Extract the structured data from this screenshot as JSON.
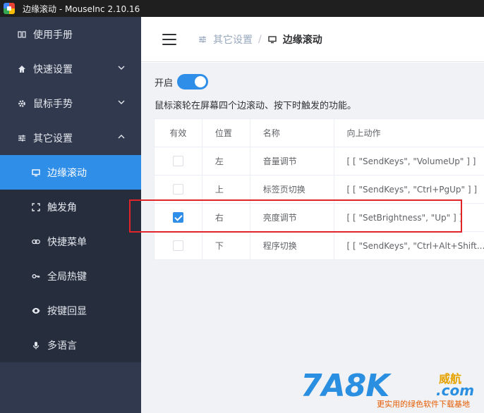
{
  "window": {
    "title": "边缘滚动 - MouseInc 2.10.16"
  },
  "sidebar": {
    "items": [
      {
        "label": "使用手册",
        "icon": "book-icon"
      },
      {
        "label": "快速设置",
        "icon": "home-icon"
      },
      {
        "label": "鼠标手势",
        "icon": "gear-icon"
      },
      {
        "label": "其它设置",
        "icon": "sliders-icon"
      },
      {
        "label": "边缘滚动",
        "icon": "monitor-icon"
      },
      {
        "label": "触发角",
        "icon": "corners-icon"
      },
      {
        "label": "快捷菜单",
        "icon": "link-icon"
      },
      {
        "label": "全局热键",
        "icon": "key-icon"
      },
      {
        "label": "按键回显",
        "icon": "eye-icon"
      },
      {
        "label": "多语言",
        "icon": "mic-icon"
      }
    ]
  },
  "header": {
    "breadcrumb": {
      "parent": "其它设置",
      "current": "边缘滚动"
    }
  },
  "main": {
    "toggle_label": "开启",
    "toggle_on": true,
    "description": "鼠标滚轮在屏幕四个边滚动、按下时触发的功能。",
    "table": {
      "headers": [
        "有效",
        "位置",
        "名称",
        "向上动作"
      ],
      "rows": [
        {
          "enabled": false,
          "position": "左",
          "name": "音量调节",
          "action": "[ [ \"SendKeys\", \"VolumeUp\" ] ]"
        },
        {
          "enabled": false,
          "position": "上",
          "name": "标签页切换",
          "action": "[ [ \"SendKeys\", \"Ctrl+PgUp\" ] ]"
        },
        {
          "enabled": true,
          "position": "右",
          "name": "亮度调节",
          "action": "[ [ \"SetBrightness\", \"Up\" ] ]"
        },
        {
          "enabled": false,
          "position": "下",
          "name": "程序切换",
          "action": "[ [ \"SendKeys\", \"Ctrl+Alt+Shift..."
        }
      ]
    }
  },
  "watermark": {
    "brand": "7A8K",
    "cn_tag": "威航",
    "domain": ".com",
    "slogan": "更实用的绿色软件下载基地"
  },
  "colors": {
    "sidebar_bg": "#30394d",
    "submenu_bg": "#262d3d",
    "accent": "#2f8ee8",
    "highlight": "#e0242a"
  }
}
